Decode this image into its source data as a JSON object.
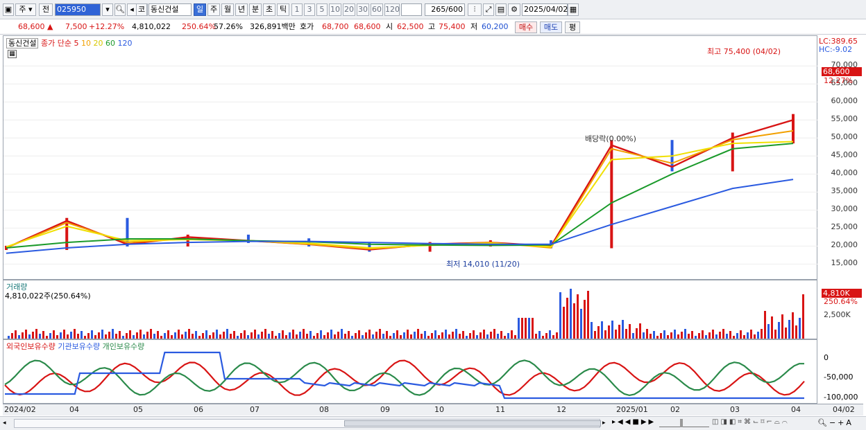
{
  "toolbar": {
    "mode_label": "주",
    "prev_label": "전",
    "code_value": "025950",
    "type_label": "코",
    "stock_name": "동신건설",
    "periods": [
      "일",
      "주",
      "월",
      "년",
      "분",
      "초",
      "틱"
    ],
    "selected_period": "일",
    "intervals": [
      "1",
      "3",
      "5",
      "10",
      "20",
      "30",
      "60",
      "120"
    ],
    "count_value": "265",
    "count_total": "/600",
    "date_value": "2025/04/02"
  },
  "quote": {
    "price": "68,600",
    "arrow": "▲",
    "change": "7,500",
    "change_pct": "+12.27%",
    "volume": "4,810,022",
    "volume_ratio": "250.64%",
    "turnover": "57.26%",
    "amount": "326,891백만",
    "ask_label": "호가",
    "ask_high": "68,700",
    "ask_low": "68,600",
    "open_label": "시",
    "open": "62,500",
    "high_label": "고",
    "high": "75,400",
    "low_label": "저",
    "low": "60,200",
    "buy_label": "매수",
    "sell_label": "매도",
    "eval_label": "평"
  },
  "price_panel": {
    "name_tag": "동신건설",
    "legend_prefix": "종가 단순",
    "ma_labels": [
      "5",
      "10",
      "20",
      "60",
      "120"
    ],
    "ma_colors": [
      "#d81414",
      "#f2a000",
      "#f0e000",
      "#1a9a2a",
      "#2a5ae0"
    ],
    "lc_label": "LC:389.65",
    "hc_label": "HC:-9.02",
    "high_note": "최고 75,400 (04/02)",
    "low_note": "최저 14,010 (11/20)",
    "dividend_note": "배당락(0.00%)",
    "last_price_tag": "68,600",
    "last_pct_tag": "12.27%",
    "y_ticks": [
      "70,000",
      "65,000",
      "60,000",
      "55,000",
      "50,000",
      "45,000",
      "40,000",
      "35,000",
      "30,000",
      "25,000",
      "20,000",
      "15,000"
    ]
  },
  "volume_panel": {
    "title": "거래량",
    "value_label": "4,810,022주(250.64%)",
    "last_tag": "4,810K",
    "last_pct": "250.64%",
    "y_tick": "2,500K"
  },
  "holdings_panel": {
    "legend": [
      "외국인보유수량",
      "기관보유수량",
      "개인보유수량"
    ],
    "colors": [
      "#d81414",
      "#2a5ae0",
      "#2a8a4a"
    ],
    "y_ticks": [
      "0",
      "-50,000",
      "-100,000"
    ]
  },
  "x_axis": [
    "2024/02",
    "04",
    "05",
    "06",
    "07",
    "08",
    "09",
    "10",
    "11",
    "12",
    "2025/01",
    "02",
    "03",
    "04"
  ],
  "x_axis_right": "04/02",
  "icons": [
    "chart-type-icon",
    "search-icon",
    "speaker-icon",
    "settings-icon",
    "calendar-icon",
    "save-icon"
  ],
  "chart_data": {
    "type": "candlestick",
    "title": "",
    "xlabel": "",
    "ylabel": "",
    "ylim": [
      12000,
      76000
    ],
    "x": [
      "2024/02",
      "04",
      "05",
      "06",
      "07",
      "08",
      "09",
      "10",
      "11",
      "12",
      "2025/01",
      "02",
      "03",
      "04/02"
    ],
    "series": [
      {
        "name": "5",
        "values": [
          19500,
          27000,
          20500,
          22500,
          21500,
          20500,
          19000,
          20500,
          21000,
          20000,
          48000,
          42000,
          50000,
          55000
        ]
      },
      {
        "name": "10",
        "values": [
          19500,
          26500,
          21000,
          22000,
          21500,
          20500,
          19200,
          20300,
          21000,
          19500,
          47000,
          43000,
          49500,
          52000
        ]
      },
      {
        "name": "20",
        "values": [
          19800,
          25500,
          21500,
          21800,
          21500,
          20800,
          19500,
          20200,
          20800,
          19800,
          44000,
          45000,
          48500,
          49000
        ]
      },
      {
        "name": "60",
        "values": [
          19500,
          21000,
          22000,
          22000,
          21500,
          21200,
          20500,
          20300,
          20200,
          20300,
          32000,
          40000,
          47000,
          48500
        ]
      },
      {
        "name": "120",
        "values": [
          18000,
          19500,
          20500,
          21000,
          21300,
          21300,
          21000,
          20700,
          20500,
          20500,
          26000,
          31000,
          36000,
          38500
        ]
      }
    ],
    "volume_last": 4810022,
    "annotations": [
      "최고 75,400 (04/02)",
      "최저 14,010 (11/20)"
    ]
  }
}
